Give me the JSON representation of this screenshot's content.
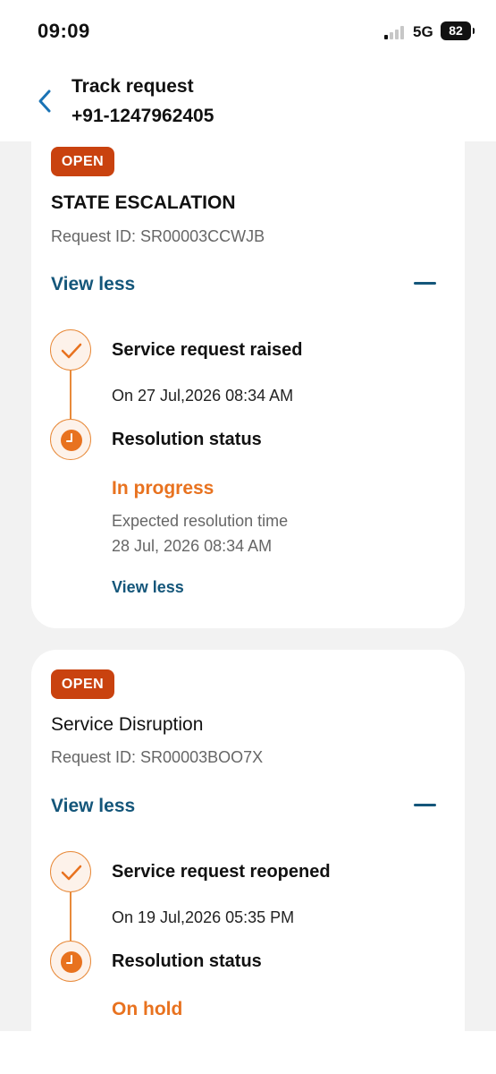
{
  "status_bar": {
    "time": "09:09",
    "network": "5G",
    "battery": "82"
  },
  "header": {
    "title": "Track request",
    "subtitle": "+91-1247962405"
  },
  "cards": [
    {
      "badge": "OPEN",
      "title": "STATE ESCALATION",
      "request_id": "Request ID: SR00003CCWJB",
      "toggle_label": "View less",
      "steps": [
        {
          "title": "Service request raised",
          "date": "On 27 Jul,2026 08:34 AM"
        },
        {
          "title": "Resolution status",
          "status": "In progress",
          "expected_label": "Expected resolution time",
          "expected_time": "28 Jul, 2026 08:34 AM",
          "link": "View less"
        }
      ]
    },
    {
      "badge": "OPEN",
      "title": "Service Disruption",
      "request_id": "Request ID: SR00003BOO7X",
      "toggle_label": "View less",
      "steps": [
        {
          "title": "Service request reopened",
          "date": "On 19 Jul,2026 05:35 PM"
        },
        {
          "title": "Resolution status",
          "status": "On hold"
        }
      ]
    }
  ],
  "colors": {
    "accent_orange": "#e8721f",
    "badge_red": "#c9420f",
    "link_blue": "#14567a"
  },
  "icons": [
    "back-chevron-icon",
    "signal-icon",
    "battery-icon",
    "minus-icon",
    "check-icon",
    "clock-icon"
  ]
}
